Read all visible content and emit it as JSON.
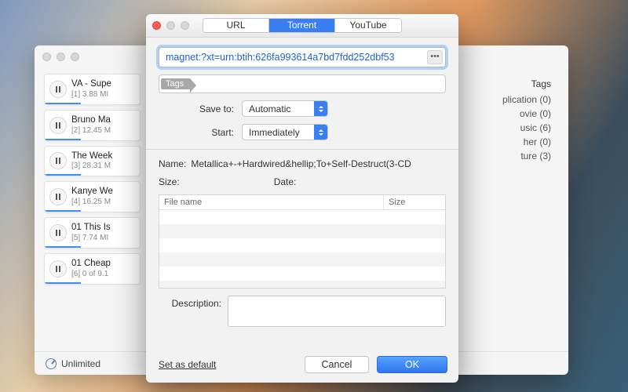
{
  "back": {
    "downloads": [
      {
        "title": "VA - Supe",
        "meta": "[1]  3.88 MI"
      },
      {
        "title": "Bruno Ma",
        "meta": "[2]  12.45 M"
      },
      {
        "title": "The Week",
        "meta": "[3]  28.31 M"
      },
      {
        "title": "Kanye We",
        "meta": "[4]  16.25 M"
      },
      {
        "title": "01 This Is",
        "meta": "[5]  7.74 MI"
      },
      {
        "title": "01 Cheap",
        "meta": "[6]  0 of 9.1"
      }
    ],
    "tags_header": "Tags",
    "tags": [
      "plication (0)",
      "ovie (0)",
      "usic (6)",
      "her (0)",
      "ture (3)"
    ],
    "footer_speed": "Unlimited"
  },
  "dialog": {
    "tabs": {
      "url": "URL",
      "torrent": "Torrent",
      "youtube": "YouTube"
    },
    "magnet": "magnet:?xt=urn:btih:626fa993614a7bd7fdd252dbf53",
    "tags_chip": "Tags",
    "save_to_label": "Save to:",
    "save_to_value": "Automatic",
    "start_label": "Start:",
    "start_value": "Immediately",
    "name_label": "Name:",
    "name_value": "Metallica+-+Hardwired&hellip;To+Self-Destruct(3-CD",
    "size_label": "Size:",
    "date_label": "Date:",
    "col_filename": "File name",
    "col_size": "Size",
    "description_label": "Description:",
    "set_default": "Set as default",
    "cancel": "Cancel",
    "ok": "OK"
  }
}
